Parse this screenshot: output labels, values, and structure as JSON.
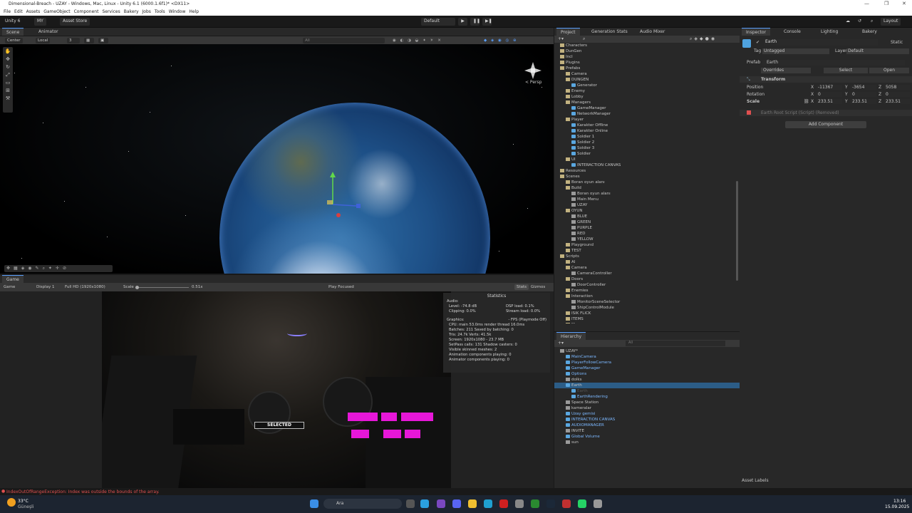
{
  "window": {
    "title": "Dimensional-Breach - UZAY - Windows, Mac, Linux - Unity 6.1 (6000.1.6f1)* <DX11>",
    "controls": [
      "—",
      "❐",
      "✕"
    ]
  },
  "menu": [
    "File",
    "Edit",
    "Assets",
    "GameObject",
    "Component",
    "Services",
    "Bakery",
    "Jobs",
    "Tools",
    "Window",
    "Help"
  ],
  "toolbar": {
    "unity": "Unity 6",
    "account": "MY",
    "asset_store": "Asset Store",
    "layout_preset": "Default",
    "layout": "Layout"
  },
  "scene": {
    "tabs": [
      "Scene",
      "Animator"
    ],
    "pivot": "Center",
    "space": "Local",
    "snap": "3",
    "persp": "< Persp",
    "search_placeholder": "All"
  },
  "game": {
    "tab": "Game",
    "mode": "Game",
    "display": "Display 1",
    "resolution": "Full HD (1920x1080)",
    "scale_label": "Scale",
    "scale_value": "0.51x",
    "play_focused": "Play Focused",
    "stats": "Stats",
    "gizmos": "Gizmos",
    "stats_panel": {
      "title": "Statistics",
      "audio": "Audio:",
      "level": "Level: -74.8 dB",
      "clipping": "Clipping: 0.0%",
      "dsp": "DSP load: 0.1%",
      "stream": "Stream load: 0.0%",
      "graphics": "Graphics:",
      "fps": "- FPS (Playmode Off)",
      "cpu": "CPU: main 53.0ms  render thread 16.0ms",
      "batches": "Batches: 211    Saved by batching: 0",
      "tris": "Tris: 24.7k      Verts: 41.5k",
      "screen": "Screen: 1920x1080 - 23.7 MB",
      "setpass": "SetPass calls: 131    Shadow casters: 0",
      "skinned": "Visible skinned meshes: 2",
      "anim": "Animation components playing: 0",
      "animator": "Animator components playing: 0"
    },
    "overlay": "SELECTED"
  },
  "project": {
    "tabs": [
      "Project",
      "Generation Stats",
      "Audio Mixer"
    ],
    "tree": [
      [
        "Characters",
        1,
        "fold"
      ],
      [
        "DunGen",
        1,
        "fold"
      ],
      [
        "Incl",
        1,
        "fold"
      ],
      [
        "Plugins",
        1,
        "fold"
      ],
      [
        "Prefabs",
        1,
        "fold"
      ],
      [
        "Camera",
        2,
        "fold"
      ],
      [
        "DUNGEN",
        2,
        "fold"
      ],
      [
        "Generator",
        3,
        "pref"
      ],
      [
        "Enemy",
        2,
        "fold"
      ],
      [
        "Lobby",
        2,
        "fold"
      ],
      [
        "Managers",
        2,
        "fold"
      ],
      [
        "GameManager",
        3,
        "pref"
      ],
      [
        "NetworkManager",
        3,
        "pref"
      ],
      [
        "Player",
        2,
        "fold"
      ],
      [
        "Karakter Offline",
        3,
        "pref"
      ],
      [
        "Karakter Online",
        3,
        "pref"
      ],
      [
        "Soldier 1",
        3,
        "pref"
      ],
      [
        "Soldier 2",
        3,
        "pref"
      ],
      [
        "Soldier 3",
        3,
        "pref"
      ],
      [
        "Soldier",
        3,
        "pref"
      ],
      [
        "UI",
        2,
        "fold"
      ],
      [
        "INTERACTION CANVAS",
        3,
        "pref"
      ],
      [
        "Resources",
        1,
        "fold"
      ],
      [
        "Scenes",
        1,
        "fold"
      ],
      [
        "Boran oyun alanı",
        2,
        "fold"
      ],
      [
        "Build",
        2,
        "fold"
      ],
      [
        "Boran oyun alanı",
        3,
        "go"
      ],
      [
        "Main Menu",
        3,
        "go"
      ],
      [
        "UZAY",
        3,
        "go"
      ],
      [
        "OYUN",
        2,
        "fold"
      ],
      [
        "BLUE",
        3,
        "go"
      ],
      [
        "GREEN",
        3,
        "go"
      ],
      [
        "PURPLE",
        3,
        "go"
      ],
      [
        "RED",
        3,
        "go"
      ],
      [
        "YELLOW",
        3,
        "go"
      ],
      [
        "Playground",
        2,
        "fold"
      ],
      [
        "TEST",
        2,
        "fold"
      ],
      [
        "Scripts",
        1,
        "fold"
      ],
      [
        "AI",
        2,
        "fold"
      ],
      [
        "Camera",
        2,
        "fold"
      ],
      [
        "CameraController",
        3,
        "go"
      ],
      [
        "Doors",
        2,
        "fold"
      ],
      [
        "DoorController",
        3,
        "go"
      ],
      [
        "Enemies",
        2,
        "fold"
      ],
      [
        "Interaction",
        2,
        "fold"
      ],
      [
        "MonitorSceneSelector",
        3,
        "go"
      ],
      [
        "ShipControlModule",
        3,
        "go"
      ],
      [
        "ISIK FLICK",
        2,
        "fold"
      ],
      [
        "ITEMS",
        2,
        "fold"
      ],
      [
        "Managers",
        2,
        "fold"
      ]
    ]
  },
  "hierarchy": {
    "tab": "Hierarchy",
    "search_placeholder": "All",
    "tree": [
      [
        "UZAY*",
        1,
        "go",
        ""
      ],
      [
        "MainCamera",
        2,
        "pref",
        "blue"
      ],
      [
        "PlayerFollowCamera",
        2,
        "pref",
        "blue"
      ],
      [
        "GameManager",
        2,
        "pref",
        "blue"
      ],
      [
        "Options",
        2,
        "pref",
        "blue"
      ],
      [
        "dolks",
        2,
        "go",
        ""
      ],
      [
        "Earth",
        2,
        "pref",
        "sel"
      ],
      [
        "Earth",
        3,
        "pref",
        "dim"
      ],
      [
        "EarthRendering",
        3,
        "pref",
        "blue"
      ],
      [
        "Space Station",
        2,
        "go",
        ""
      ],
      [
        "kameralar",
        2,
        "go",
        ""
      ],
      [
        "Uzay gemisi",
        2,
        "pref",
        "blue"
      ],
      [
        "INTERACTION CANVAS",
        2,
        "pref",
        "blue"
      ],
      [
        "AUDIOMANAGER",
        2,
        "pref",
        "blue"
      ],
      [
        "INVITE",
        2,
        "go",
        ""
      ],
      [
        "Global Volume",
        2,
        "pref",
        "blue"
      ],
      [
        "sun",
        2,
        "go",
        ""
      ]
    ]
  },
  "inspector": {
    "tabs": [
      "Inspector",
      "Console",
      "Lighting",
      "Bakery"
    ],
    "name": "Earth",
    "static": "Static",
    "tag_label": "Tag",
    "tag": "Untagged",
    "layer_label": "Layer",
    "layer": "Default",
    "prefab_label": "Prefab",
    "prefab": "Earth",
    "overrides": "Overrides",
    "select": "Select",
    "open": "Open",
    "transform": "Transform",
    "position": {
      "label": "Position",
      "x": "-11367",
      "y": "-3654",
      "z": "5058"
    },
    "rotation": {
      "label": "Rotation",
      "x": "0",
      "y": "0",
      "z": "0"
    },
    "scale": {
      "label": "Scale",
      "x": "233.51",
      "y": "233.51",
      "z": "233.51"
    },
    "missing": "Earth Root Script (Script) (Removed)",
    "add_component": "Add Component",
    "asset_labels": "Asset Labels"
  },
  "status": {
    "error": "IndexOutOfRangeException: Index was outside the bounds of the array."
  },
  "taskbar": {
    "temp": "33°C",
    "weather": "Güneşli",
    "search": "Ara",
    "time": "13:16",
    "date": "15.09.2025"
  },
  "colors": {
    "accent": "#5aa0ff",
    "selection": "#2c5d87",
    "prefab": "#7cb8ff",
    "error": "#e05050"
  }
}
